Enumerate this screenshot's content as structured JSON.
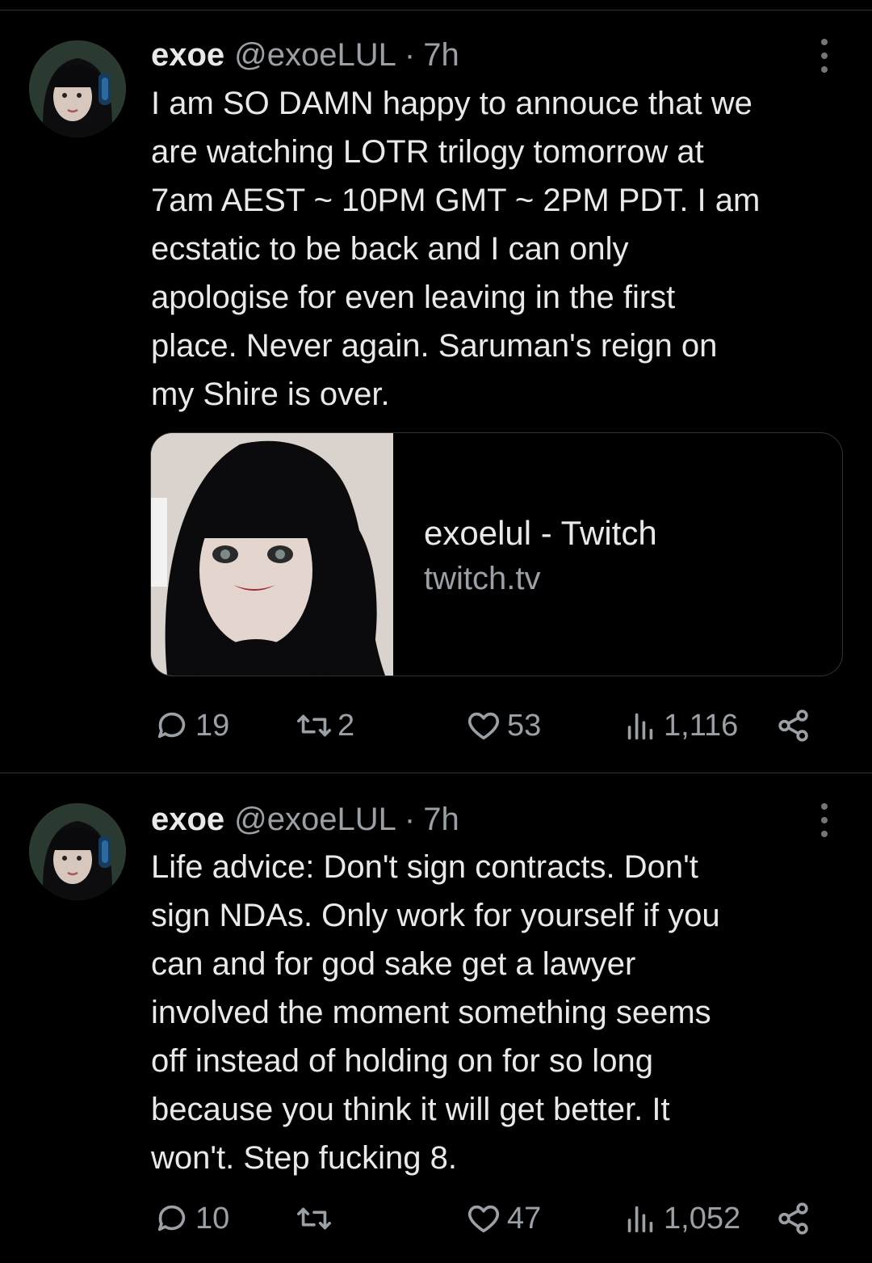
{
  "tweets": [
    {
      "display_name": "exoe",
      "handle": "@exoeLUL",
      "separator": "·",
      "time": "7h",
      "text": "I am SO DAMN happy to annouce that we\nare watching LOTR trilogy tomorrow at\n7am AEST ~ 10PM GMT ~ 2PM PDT. I am\necstatic to be back and I can only\napologise for even leaving in the first\nplace. Never again. Saruman's reign on\nmy Shire is over.",
      "card": {
        "title": "exoelul - Twitch",
        "domain": "twitch.tv"
      },
      "stats": {
        "replies": "19",
        "retweets": "2",
        "likes": "53",
        "views": "1,116"
      }
    },
    {
      "display_name": "exoe",
      "handle": "@exoeLUL",
      "separator": "·",
      "time": "7h",
      "text": "Life advice: Don't sign contracts. Don't\nsign NDAs. Only work for yourself if you\ncan and for god sake get a lawyer\ninvolved the moment something seems\noff instead of holding on for so long\nbecause you think it will get better. It\nwon't. Step fucking 8.",
      "stats": {
        "replies": "10",
        "retweets": "",
        "likes": "47",
        "views": "1,052"
      }
    }
  ],
  "icons": {
    "more": "more-vertical-icon",
    "reply": "reply-icon",
    "retweet": "retweet-icon",
    "like": "heart-icon",
    "views": "views-icon",
    "share": "share-icon"
  },
  "colors": {
    "background": "#000000",
    "text": "#e7e9ea",
    "muted": "#9aa0a6",
    "border": "#2f3336"
  }
}
